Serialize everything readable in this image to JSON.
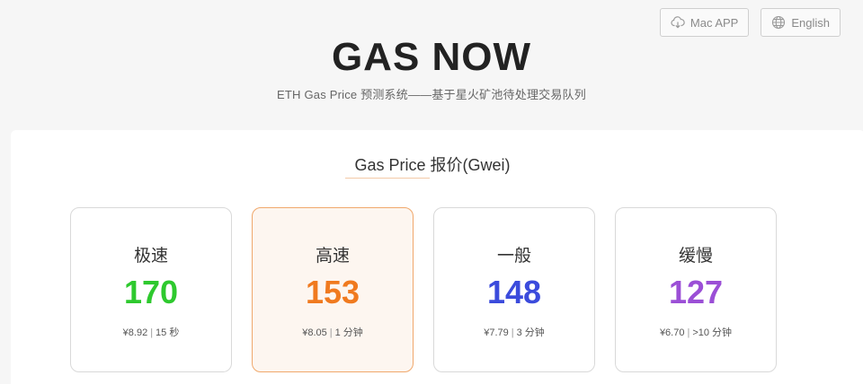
{
  "header": {
    "mac_app_label": "Mac APP",
    "mac_app_icon": "cloud-download-icon",
    "language_label": "English",
    "language_icon": "globe-icon"
  },
  "hero": {
    "title": "GAS NOW",
    "subtitle": "ETH Gas Price 预测系统——基于星火矿池待处理交易队列"
  },
  "panel": {
    "title": "Gas Price 报价(Gwei)"
  },
  "cards": [
    {
      "label": "极速",
      "price": "170",
      "cny": "¥8.92",
      "time": "15 秒",
      "color": "#2ec92e",
      "active": false
    },
    {
      "label": "高速",
      "price": "153",
      "cny": "¥8.05",
      "time": "1 分钟",
      "color": "#f07a1f",
      "active": true
    },
    {
      "label": "一般",
      "price": "148",
      "cny": "¥7.79",
      "time": "3 分钟",
      "color": "#3b4bdc",
      "active": false
    },
    {
      "label": "缓慢",
      "price": "127",
      "cny": "¥6.70",
      "time": ">10 分钟",
      "color": "#9b4fd6",
      "active": false
    }
  ],
  "colors": {
    "accent_underline": "#f3c9a8",
    "active_border": "#f0a86c",
    "active_bg": "#fdf6f0"
  }
}
